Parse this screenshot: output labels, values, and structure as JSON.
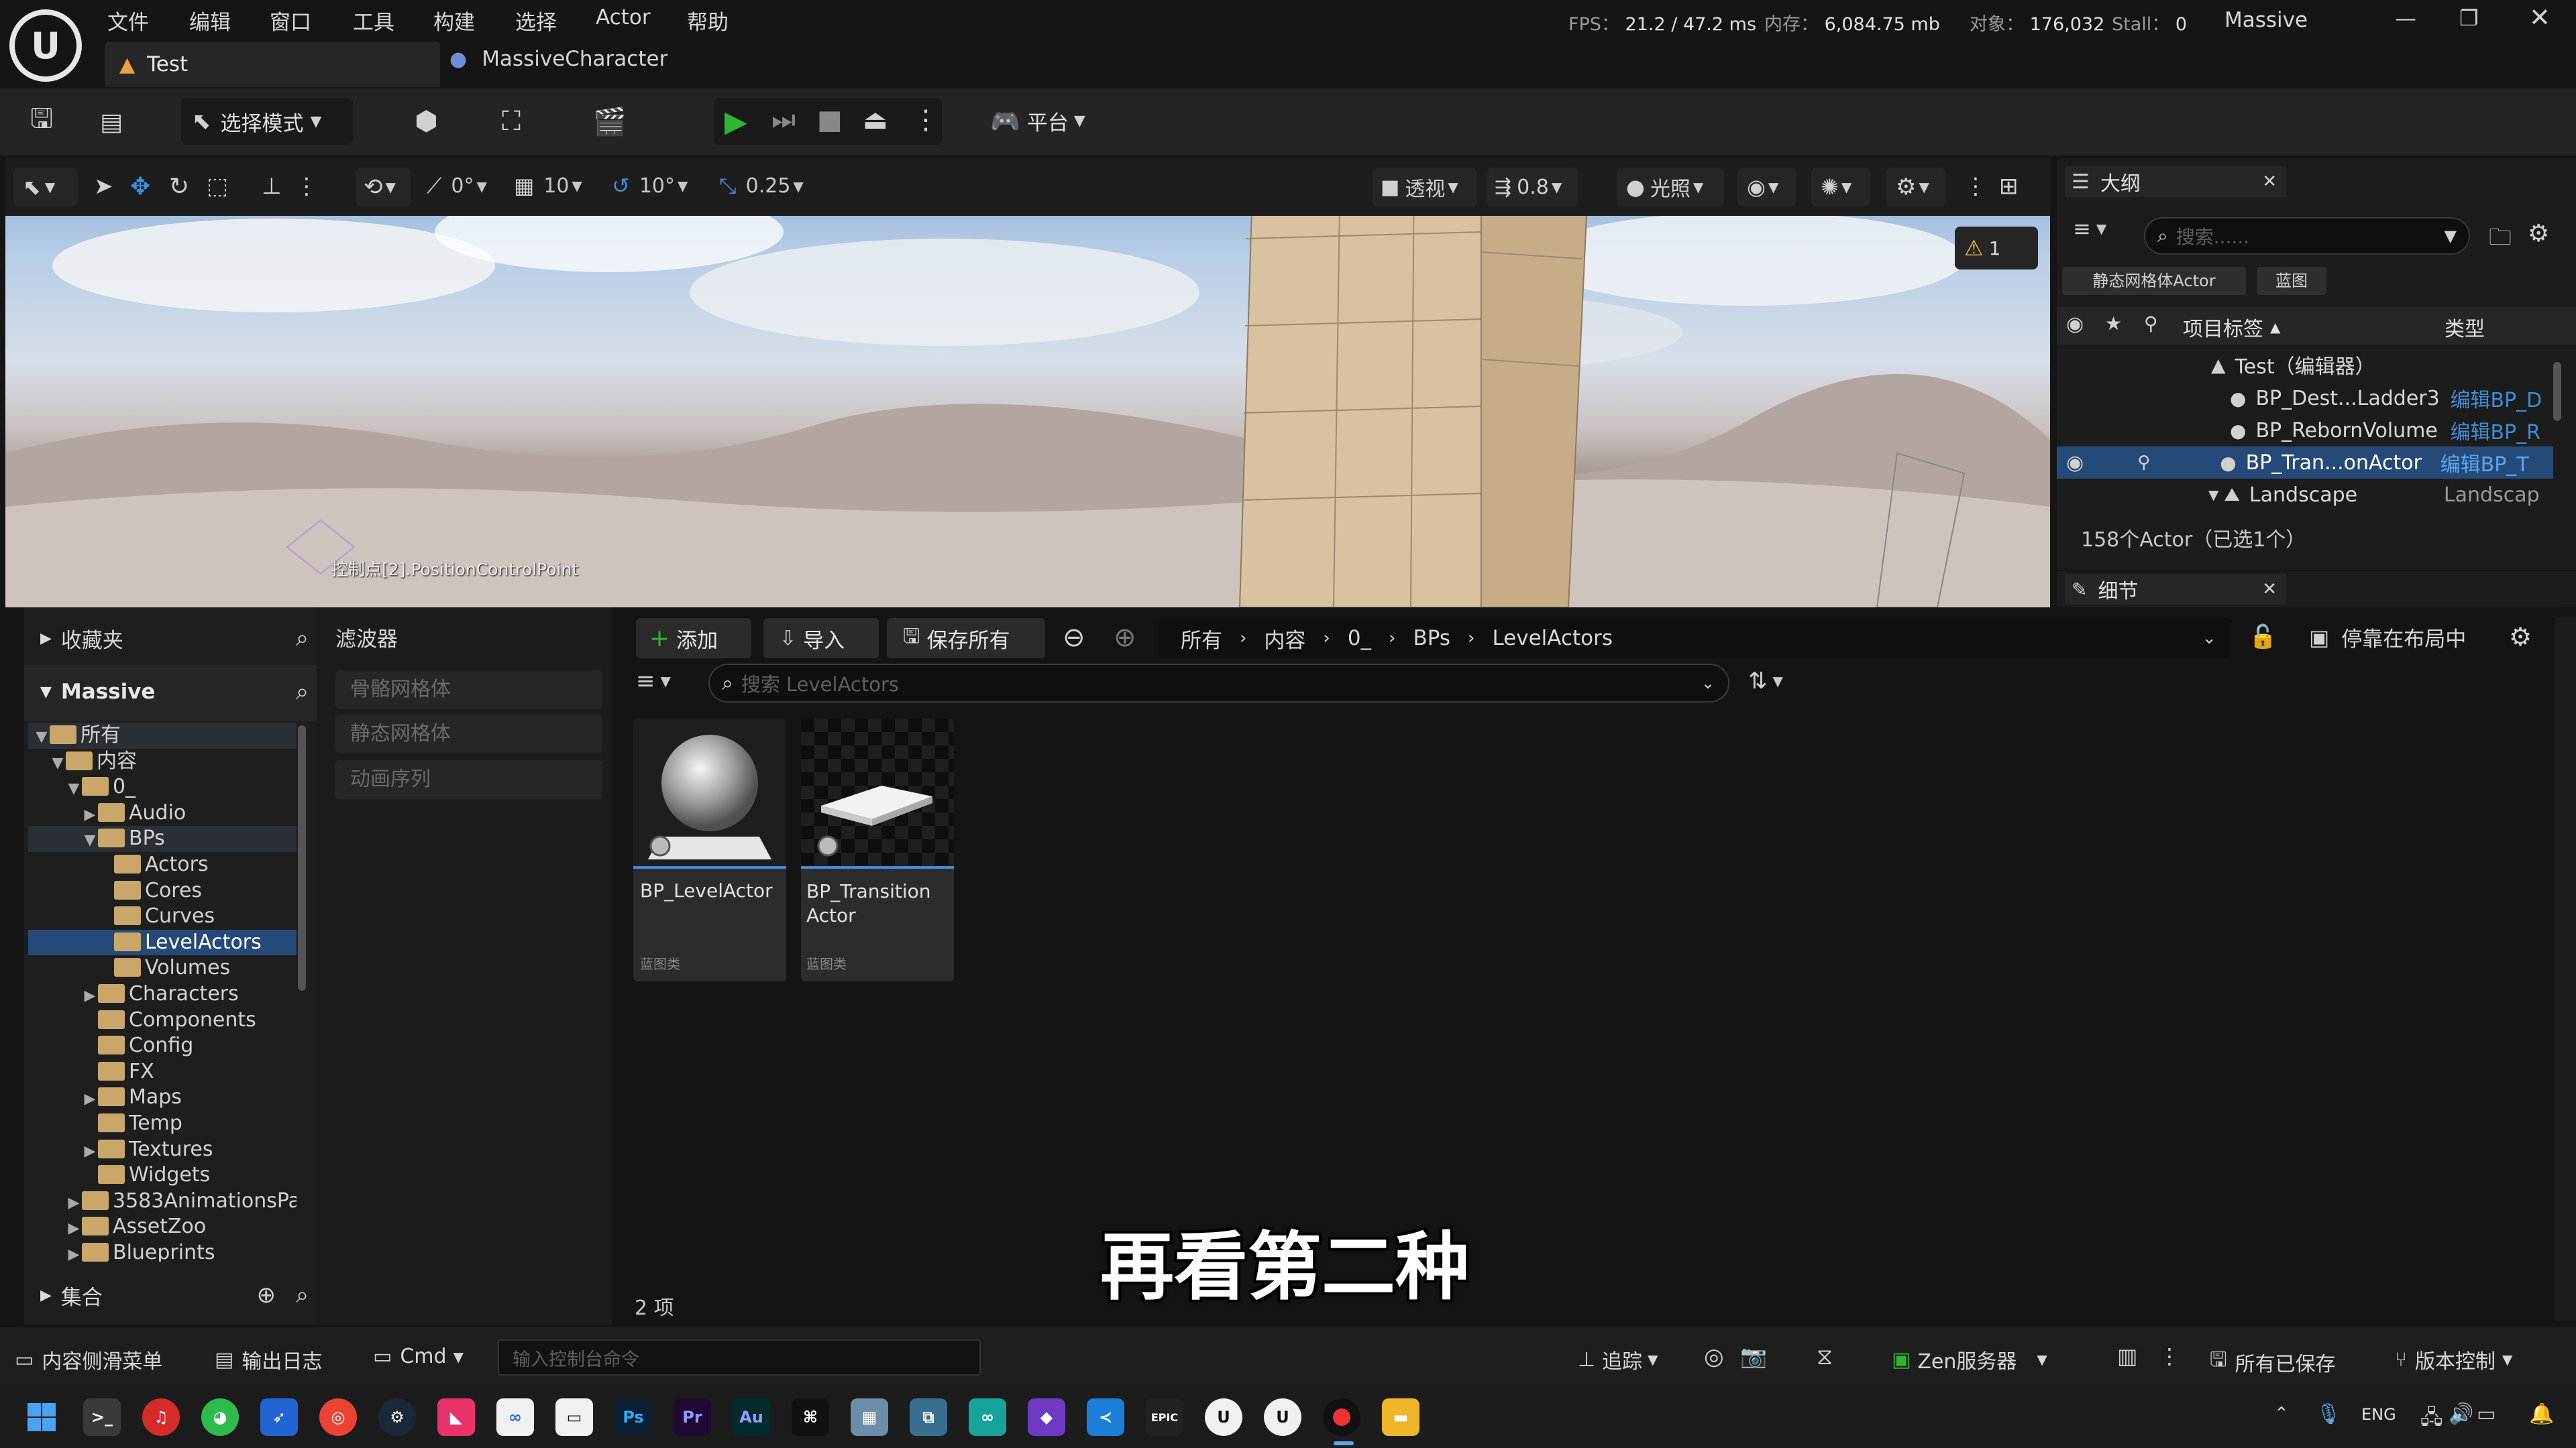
{
  "app": {
    "window_title": "Massive"
  },
  "menu": [
    "文件",
    "编辑",
    "窗口",
    "工具",
    "构建",
    "选择",
    "Actor",
    "帮助"
  ],
  "stats": {
    "fps_label": "FPS：",
    "fps": "21.2",
    "ms": "/ 47.2 ms",
    "mem_label": "内存：",
    "mem": "6,084.75 mb",
    "obj_label": "对象：",
    "obj": "176,032",
    "stall_label": "Stall：",
    "stall": "0"
  },
  "tabs": [
    {
      "label": "Test"
    },
    {
      "label": "MassiveCharacter"
    }
  ],
  "toolbar": {
    "mode": "选择模式",
    "platform": "平台"
  },
  "viewport_toolbar": {
    "angle": "0°",
    "grid": "10",
    "rotation": "10°",
    "scale": "0.25",
    "perspective": "透视",
    "speed": "0.8",
    "lighting": "光照"
  },
  "viewport": {
    "warning_count": "1",
    "label": "控制点[2].PositionControlPoint"
  },
  "outliner": {
    "title": "大纲",
    "search_placeholder": "搜索......",
    "chips": [
      "静态网格体Actor",
      "蓝图"
    ],
    "col_label": "项目标签",
    "col_type": "类型",
    "rows": [
      {
        "label": "Test（编辑器）",
        "type": ""
      },
      {
        "label": "BP_Dest...Ladder3",
        "type": "编辑BP_D"
      },
      {
        "label": "BP_RebornVolume",
        "type": "编辑BP_R"
      },
      {
        "label": "BP_Tran...onActor",
        "type": "编辑BP_T"
      },
      {
        "label": "Landscape",
        "type": "Landscap"
      }
    ],
    "count": "158个Actor（已选1个）"
  },
  "details": {
    "title": "细节"
  },
  "content_browser": {
    "favorites": "收藏夹",
    "project": "Massive",
    "collections": "集合",
    "filters_title": "滤波器",
    "filters": [
      "骨骼网格体",
      "静态网格体",
      "动画序列"
    ],
    "add": "添加",
    "import": "导入",
    "save_all": "保存所有",
    "path": [
      "所有",
      "内容",
      "0_",
      "BPs",
      "LevelActors"
    ],
    "dock": "停靠在布局中",
    "search_placeholder": "搜索 LevelActors",
    "item_count": "2 项",
    "tree": [
      {
        "label": "所有",
        "depth": 0,
        "arrow": "▼"
      },
      {
        "label": "内容",
        "depth": 1,
        "arrow": "▼"
      },
      {
        "label": "0_",
        "depth": 2,
        "arrow": "▼"
      },
      {
        "label": "Audio",
        "depth": 3,
        "arrow": "▶"
      },
      {
        "label": "BPs",
        "depth": 3,
        "arrow": "▼"
      },
      {
        "label": "Actors",
        "depth": 4,
        "arrow": ""
      },
      {
        "label": "Cores",
        "depth": 4,
        "arrow": ""
      },
      {
        "label": "Curves",
        "depth": 4,
        "arrow": ""
      },
      {
        "label": "LevelActors",
        "depth": 4,
        "arrow": ""
      },
      {
        "label": "Volumes",
        "depth": 4,
        "arrow": ""
      },
      {
        "label": "Characters",
        "depth": 3,
        "arrow": "▶"
      },
      {
        "label": "Components",
        "depth": 3,
        "arrow": ""
      },
      {
        "label": "Config",
        "depth": 3,
        "arrow": ""
      },
      {
        "label": "FX",
        "depth": 3,
        "arrow": ""
      },
      {
        "label": "Maps",
        "depth": 3,
        "arrow": "▶"
      },
      {
        "label": "Temp",
        "depth": 3,
        "arrow": ""
      },
      {
        "label": "Textures",
        "depth": 3,
        "arrow": "▶"
      },
      {
        "label": "Widgets",
        "depth": 3,
        "arrow": ""
      },
      {
        "label": "3583AnimationsPa",
        "depth": 2,
        "arrow": "▶"
      },
      {
        "label": "AssetZoo",
        "depth": 2,
        "arrow": "▶"
      },
      {
        "label": "Blueprints",
        "depth": 2,
        "arrow": "▶"
      }
    ],
    "assets": [
      {
        "name": "BP_LevelActor",
        "type": "蓝图类"
      },
      {
        "name": "BP_Transition Actor",
        "type": "蓝图类"
      }
    ]
  },
  "statusbar": {
    "drawer": "内容侧滑菜单",
    "log": "输出日志",
    "cmd": "Cmd",
    "cmd_placeholder": "输入控制台命令",
    "trace": "追踪",
    "zen": "Zen服务器",
    "saved": "所有已保存",
    "vcs": "版本控制"
  },
  "subtitle": "再看第二种",
  "taskbar": {
    "lang": "ENG"
  },
  "colors": {
    "accent": "#3c8dd6",
    "selection": "#264a77",
    "folder": "#c9a66a",
    "play": "#2fb52f"
  }
}
